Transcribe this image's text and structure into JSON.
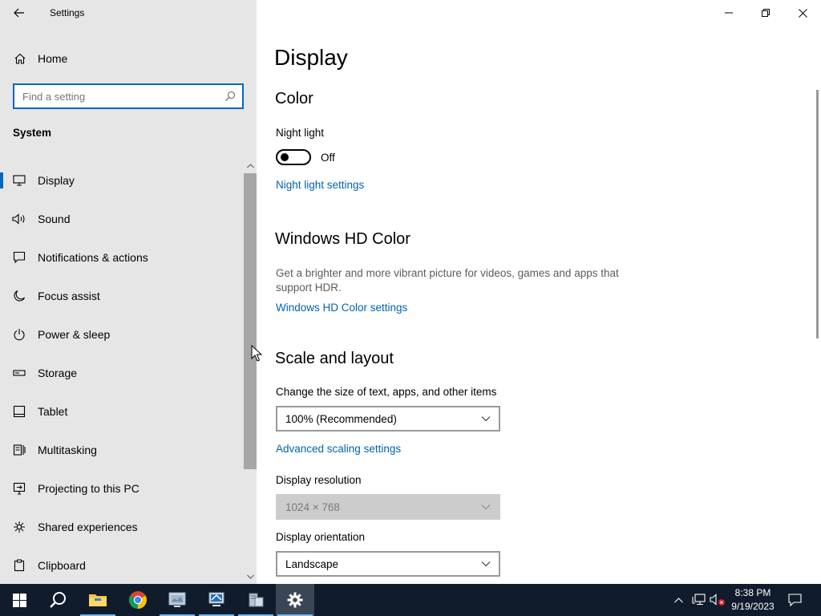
{
  "window": {
    "title": "Settings"
  },
  "sidebar": {
    "home_label": "Home",
    "search_placeholder": "Find a setting",
    "section_title": "System",
    "items": [
      {
        "label": "Display",
        "icon": "monitor-icon",
        "active": true
      },
      {
        "label": "Sound",
        "icon": "speaker-icon"
      },
      {
        "label": "Notifications & actions",
        "icon": "notification-icon"
      },
      {
        "label": "Focus assist",
        "icon": "moon-icon"
      },
      {
        "label": "Power & sleep",
        "icon": "power-icon"
      },
      {
        "label": "Storage",
        "icon": "storage-icon"
      },
      {
        "label": "Tablet",
        "icon": "tablet-icon"
      },
      {
        "label": "Multitasking",
        "icon": "multitasking-icon"
      },
      {
        "label": "Projecting to this PC",
        "icon": "projector-icon"
      },
      {
        "label": "Shared experiences",
        "icon": "share-icon"
      },
      {
        "label": "Clipboard",
        "icon": "clipboard-icon"
      }
    ]
  },
  "main": {
    "title": "Display",
    "color": {
      "heading": "Color",
      "night_light_label": "Night light",
      "night_light_state": "Off",
      "night_light_link": "Night light settings"
    },
    "hd_color": {
      "heading": "Windows HD Color",
      "description": "Get a brighter and more vibrant picture for videos, games and apps that support HDR.",
      "link": "Windows HD Color settings"
    },
    "scale": {
      "heading": "Scale and layout",
      "size_label": "Change the size of text, apps, and other items",
      "size_value": "100% (Recommended)",
      "advanced_link": "Advanced scaling settings",
      "resolution_label": "Display resolution",
      "resolution_value": "1024 × 768",
      "orientation_label": "Display orientation",
      "orientation_value": "Landscape"
    }
  },
  "taskbar": {
    "time": "8:38 PM",
    "date": "9/19/2023"
  },
  "colors": {
    "accent": "#0067c0",
    "link": "#0063b1",
    "sidebar_bg": "#e6e6e6",
    "taskbar_bg": "#101c2c"
  }
}
